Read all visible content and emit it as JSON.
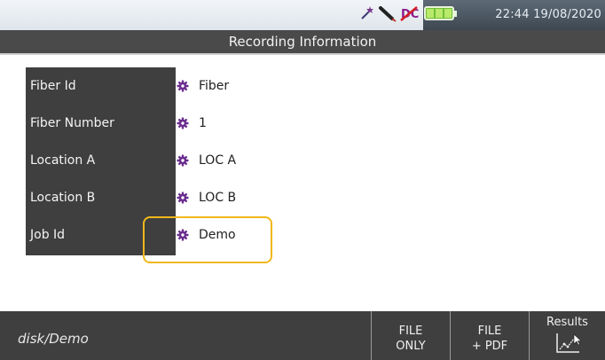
{
  "status_bar": {
    "time": "22:44",
    "date": "19/08/2020",
    "icons": [
      "wand-icon",
      "probe-icon",
      "no-connection-icon",
      "battery-icon"
    ]
  },
  "title": "Recording Information",
  "fields": [
    {
      "label": "Fiber Id",
      "value": "Fiber"
    },
    {
      "label": "Fiber Number",
      "value": "1"
    },
    {
      "label": "Location A",
      "value": "LOC A"
    },
    {
      "label": "Location B",
      "value": "LOC B"
    },
    {
      "label": "Job Id",
      "value": "Demo"
    }
  ],
  "bottom_bar": {
    "path": "disk/Demo",
    "softkeys": [
      {
        "line1": "FILE",
        "line2": "ONLY"
      },
      {
        "line1": "FILE",
        "line2": "+ PDF"
      },
      {
        "line1": "Results"
      }
    ]
  },
  "colors": {
    "accent_gear": "#6a2c8e",
    "highlight": "#f0b81b",
    "battery": "#6fbf38"
  }
}
